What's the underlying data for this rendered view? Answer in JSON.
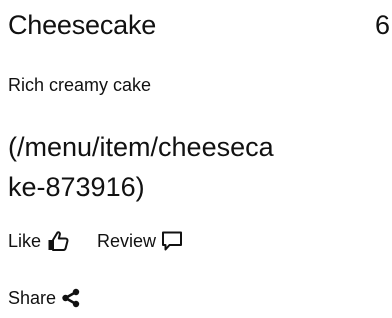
{
  "item": {
    "name": "Cheesecake",
    "price": "6",
    "description": "Rich creamy cake",
    "link_text": "(/menu/item/cheesecake-873916)"
  },
  "actions": {
    "like_label": "Like",
    "like_icon": "thumbs-up-icon",
    "review_label": "Review",
    "review_icon": "speech-bubble-icon",
    "share_label": "Share",
    "share_icon": "share-icon"
  }
}
